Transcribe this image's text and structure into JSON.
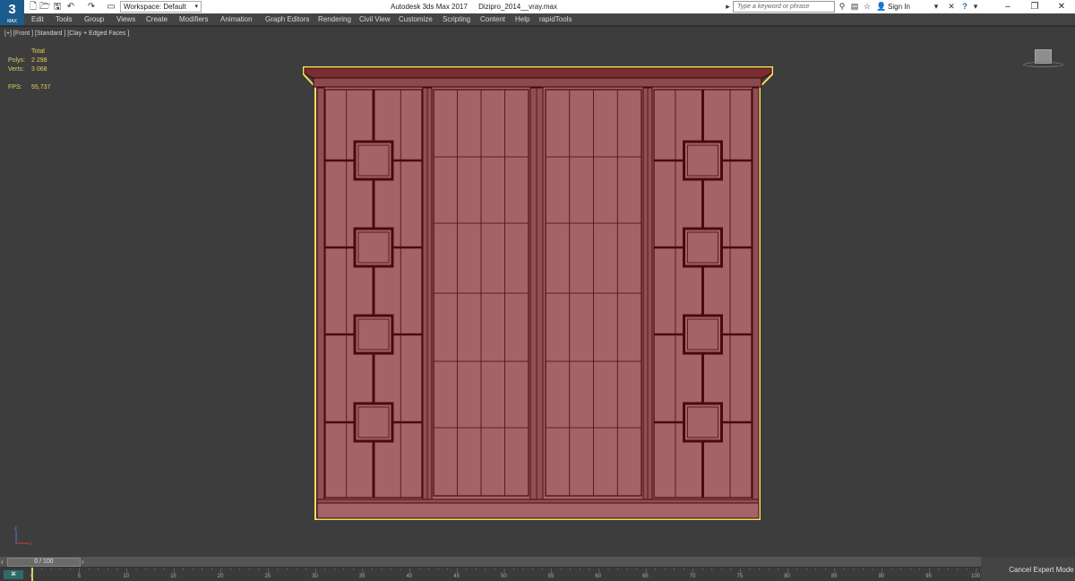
{
  "app": {
    "logo_text": "3",
    "logo_sub": "MAX",
    "title": "Autodesk 3ds Max 2017",
    "file": "Dizipro_2014__vray.max",
    "workspace_label": "Workspace: Default",
    "search_placeholder": "Type a keyword or phrase",
    "sign_in": "Sign In"
  },
  "menu": [
    "Edit",
    "Tools",
    "Group",
    "Views",
    "Create",
    "Modifiers",
    "Animation",
    "Graph Editors",
    "Rendering",
    "Civil View",
    "Customize",
    "Scripting",
    "Content",
    "Help",
    "rapidTools"
  ],
  "viewport": {
    "label": "[+] [Front ] [Standard ] [Clay + Edged Faces ]",
    "stats": {
      "total_label": "Total",
      "polys_label": "Polys:",
      "polys_value": "2 298",
      "verts_label": "Verts:",
      "verts_value": "3 068",
      "fps_label": "FPS:",
      "fps_value": "55,737"
    }
  },
  "timeline": {
    "frame_display": "0 / 100",
    "ticks": [
      "0",
      "5",
      "10",
      "15",
      "20",
      "25",
      "30",
      "35",
      "40",
      "45",
      "50",
      "55",
      "60",
      "65",
      "70",
      "75",
      "80",
      "85",
      "90",
      "95",
      "100"
    ],
    "cancel_expert": "Cancel Expert Mode"
  },
  "colors": {
    "model_fill": "#a26468",
    "model_line": "#4a0a10",
    "selection": "#f0e060",
    "viewport_bg": "#3d3d3d",
    "stat_text": "#e0d060"
  },
  "icons": [
    "new-file-icon",
    "open-folder-icon",
    "save-icon",
    "undo-icon",
    "redo-icon",
    "binoculars-icon",
    "star-icon",
    "help-icon",
    "user-icon",
    "close-x-icon",
    "minimize-icon",
    "restore-icon",
    "close-icon"
  ]
}
